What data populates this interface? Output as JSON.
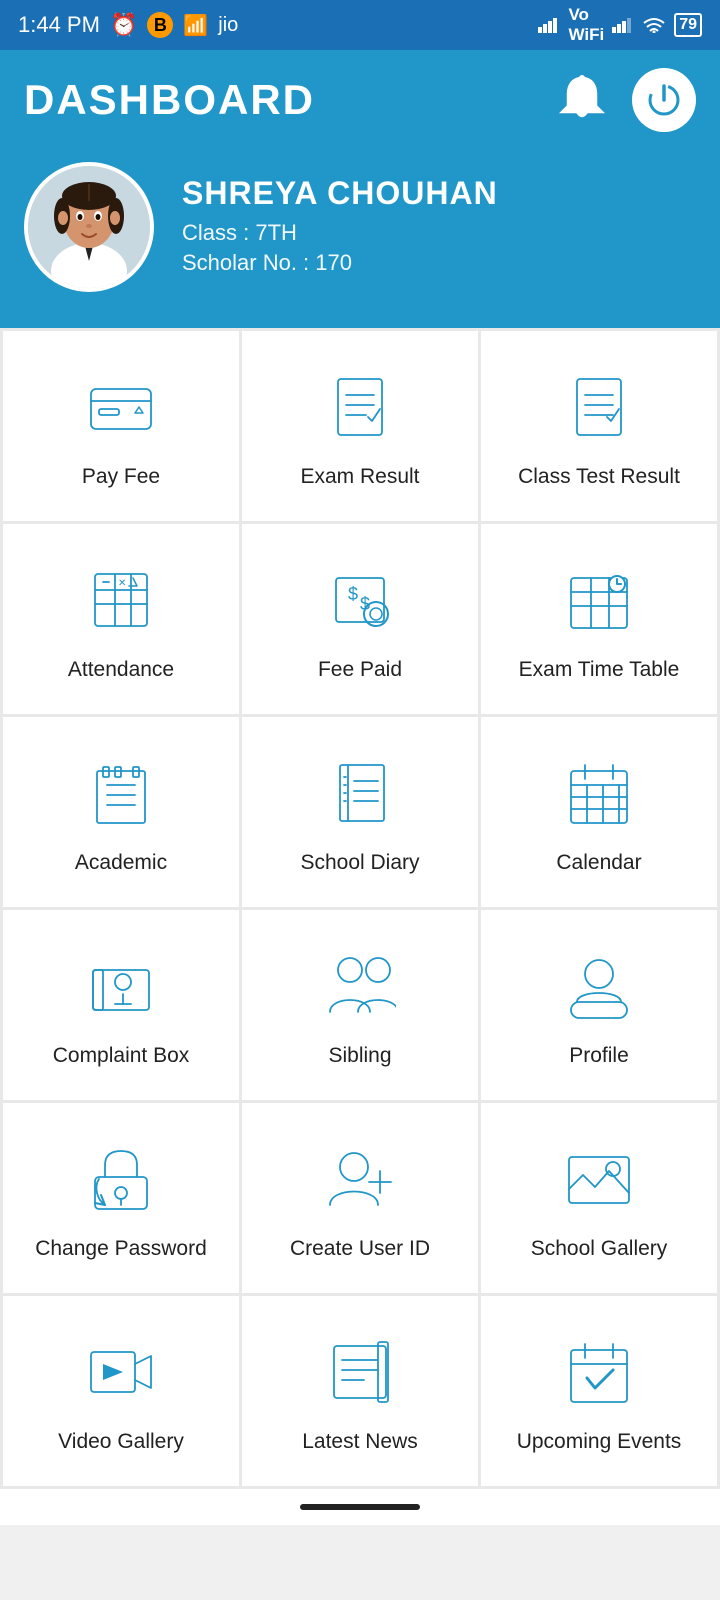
{
  "statusBar": {
    "time": "1:44 PM",
    "batteryLevel": "79"
  },
  "header": {
    "title": "DASHBOARD",
    "bellIcon": "bell-icon",
    "powerIcon": "power-icon"
  },
  "profile": {
    "name": "SHREYA  CHOUHAN",
    "class": "Class : 7TH",
    "scholarNo": "Scholar No. : 170"
  },
  "grid": [
    {
      "id": "pay-fee",
      "label": "Pay Fee",
      "icon": "card-icon"
    },
    {
      "id": "exam-result",
      "label": "Exam Result",
      "icon": "result-icon"
    },
    {
      "id": "class-test-result",
      "label": "Class Test Result",
      "icon": "class-test-icon"
    },
    {
      "id": "attendance",
      "label": "Attendance",
      "icon": "attendance-icon"
    },
    {
      "id": "fee-paid",
      "label": "Fee Paid",
      "icon": "fee-paid-icon"
    },
    {
      "id": "exam-time-table",
      "label": "Exam Time Table",
      "icon": "timetable-icon"
    },
    {
      "id": "academic",
      "label": "Academic",
      "icon": "academic-icon"
    },
    {
      "id": "school-diary",
      "label": "School Diary",
      "icon": "diary-icon"
    },
    {
      "id": "calendar",
      "label": "Calendar",
      "icon": "calendar-icon"
    },
    {
      "id": "complaint-box",
      "label": "Complaint Box",
      "icon": "complaint-icon"
    },
    {
      "id": "sibling",
      "label": "Sibling",
      "icon": "sibling-icon"
    },
    {
      "id": "profile",
      "label": "Profile",
      "icon": "profile-icon"
    },
    {
      "id": "change-password",
      "label": "Change Password",
      "icon": "change-password-icon"
    },
    {
      "id": "create-user-id",
      "label": "Create User ID",
      "icon": "create-user-icon"
    },
    {
      "id": "school-gallery",
      "label": "School Gallery",
      "icon": "gallery-icon"
    },
    {
      "id": "video-gallery",
      "label": "Video Gallery",
      "icon": "video-gallery-icon"
    },
    {
      "id": "latest-news",
      "label": "Latest News",
      "icon": "news-icon"
    },
    {
      "id": "upcoming-events",
      "label": "Upcoming Events",
      "icon": "events-icon"
    }
  ]
}
